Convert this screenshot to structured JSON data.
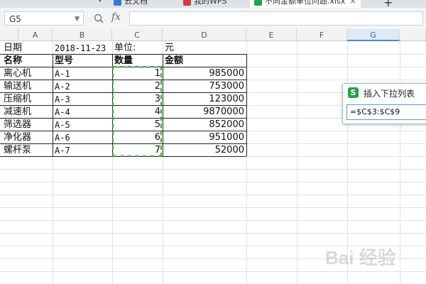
{
  "tabs": [
    {
      "label": "云文档",
      "color": "#3a78d6"
    },
    {
      "label": "我的WPS",
      "color": "#d33b3b"
    },
    {
      "label": "不同金额单位问题.xlsx",
      "color": "#2aa04a"
    }
  ],
  "tab_new_label": "+",
  "name_box": "G5",
  "formula_fx": "fx",
  "formula_value": "",
  "columns": [
    "A",
    "B",
    "C",
    "D",
    "E",
    "F",
    "G"
  ],
  "selected_column": "G",
  "header_row": {
    "date_label": "日期",
    "date_value": "2018-11-23",
    "unit_label": "单位:",
    "unit_value": "元"
  },
  "table_headers": [
    "名称",
    "型号",
    "数量",
    "金额"
  ],
  "rows": [
    {
      "name": "离心机",
      "model": "A-1",
      "qty": "1",
      "amount": "985000"
    },
    {
      "name": "输送机",
      "model": "A-2",
      "qty": "2",
      "amount": "753000"
    },
    {
      "name": "压缩机",
      "model": "A-3",
      "qty": "3",
      "amount": "123000"
    },
    {
      "name": "减速机",
      "model": "A-4",
      "qty": "4",
      "amount": "9870000"
    },
    {
      "name": "筛选器",
      "model": "A-5",
      "qty": "5",
      "amount": "852000"
    },
    {
      "name": "净化器",
      "model": "A-6",
      "qty": "6",
      "amount": "951000"
    },
    {
      "name": "螺杆泵",
      "model": "A-7",
      "qty": "7",
      "amount": "52000"
    }
  ],
  "popup": {
    "icon": "S",
    "title": "插入下拉列表",
    "value": "=$C$3:$C$9"
  },
  "watermark": "Bai 经验"
}
